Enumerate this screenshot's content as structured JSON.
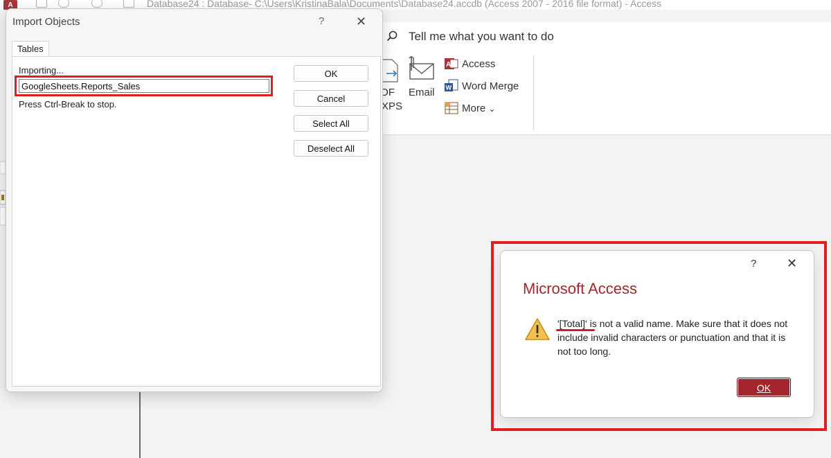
{
  "app": {
    "window_title": "Database24 : Database- C:\\Users\\KristinaBala\\Documents\\Database24.accdb (Access 2007 - 2016 file format)  -  Access",
    "icon_letter": "A",
    "tell_me": "Tell me what you want to do"
  },
  "ribbon": {
    "pdf_label_line1": "DF",
    "pdf_label_line2": "XPS",
    "email_label": "Email",
    "access_label": "Access",
    "word_merge_label": "Word Merge",
    "more_label": "More",
    "more_chevron": "⌄"
  },
  "import_dialog": {
    "title": "Import Objects",
    "help": "?",
    "close": "✕",
    "tab": "Tables",
    "importing_label": "Importing...",
    "file_name": "GoogleSheets.Reports_Sales",
    "stop_hint": "Press Ctrl-Break to stop.",
    "buttons": {
      "ok": "OK",
      "cancel": "Cancel",
      "select_all": "Select All",
      "deselect_all": "Deselect All"
    }
  },
  "alert": {
    "help": "?",
    "close": "✕",
    "heading": "Microsoft Access",
    "message": "'[Total]' is not a valid name. Make sure that it does not include invalid characters or punctuation and that it is not too long.",
    "ok_label": "OK"
  },
  "colors": {
    "access_red": "#a4262c",
    "highlight_red": "#e02020",
    "warning_yellow": "#f2c14e"
  },
  "icons": {
    "app": "access-app-icon",
    "search": "search-icon",
    "pdf": "pdf-export-icon",
    "email": "email-icon",
    "access": "access-export-icon",
    "word_merge": "word-merge-icon",
    "more": "more-icon",
    "warning": "warning-icon"
  }
}
